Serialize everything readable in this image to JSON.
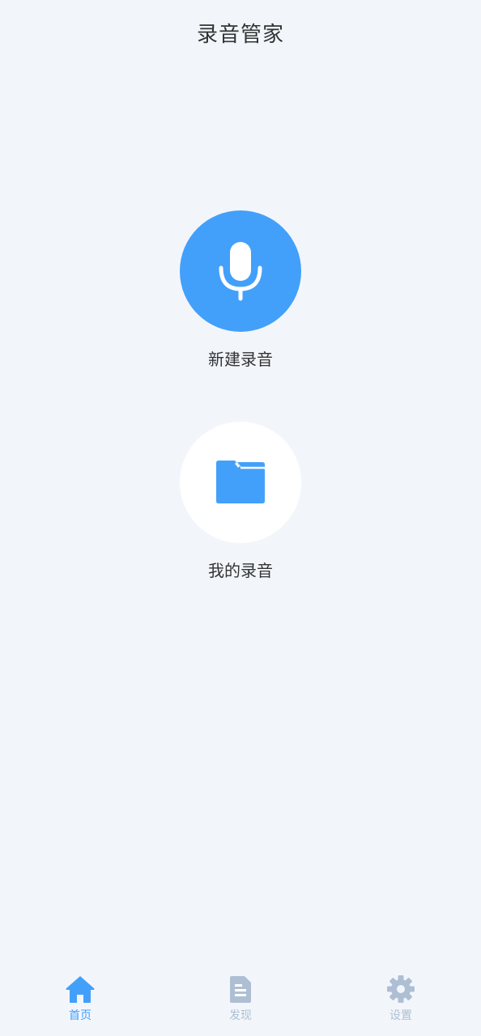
{
  "header": {
    "title": "录音管家"
  },
  "actions": [
    {
      "label": "新建录音",
      "icon": "microphone-icon"
    },
    {
      "label": "我的录音",
      "icon": "folder-icon"
    }
  ],
  "tabbar": {
    "items": [
      {
        "label": "首页",
        "icon": "home-icon",
        "active": true
      },
      {
        "label": "发现",
        "icon": "document-icon",
        "active": false
      },
      {
        "label": "设置",
        "icon": "gear-icon",
        "active": false
      }
    ]
  },
  "colors": {
    "accent": "#43a0fa",
    "background": "#f2f6fb",
    "inactive_tab": "#aebfd4",
    "text": "#333333"
  }
}
